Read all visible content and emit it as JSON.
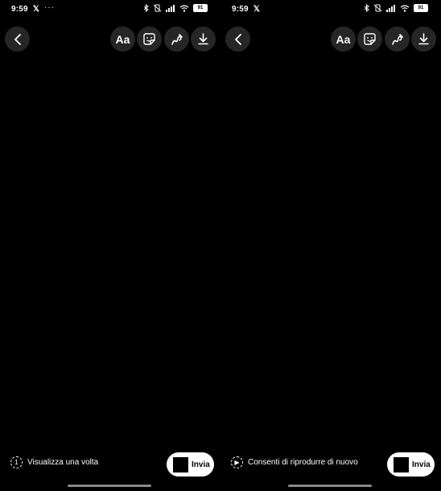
{
  "status_bar": {
    "time": "9:59",
    "x_icon": "x-logo-icon",
    "more": "···",
    "battery": "91"
  },
  "toolbar": {
    "back_icon": "chevron-left-icon",
    "text_tool": "Aa",
    "sticker_icon": "sticker-icon",
    "draw_icon": "draw-icon",
    "download_icon": "download-icon"
  },
  "left_panel": {
    "option_icon_text": "1",
    "option_label": "Visualizza una volta",
    "send_label": "Invia"
  },
  "right_panel": {
    "option_icon_text": "▶",
    "option_label": "Consenti di riprodurre di nuovo",
    "send_label": "Invia"
  },
  "colors": {
    "background": "#000000",
    "button_bg": "#262626",
    "send_bg": "#ffffff"
  }
}
